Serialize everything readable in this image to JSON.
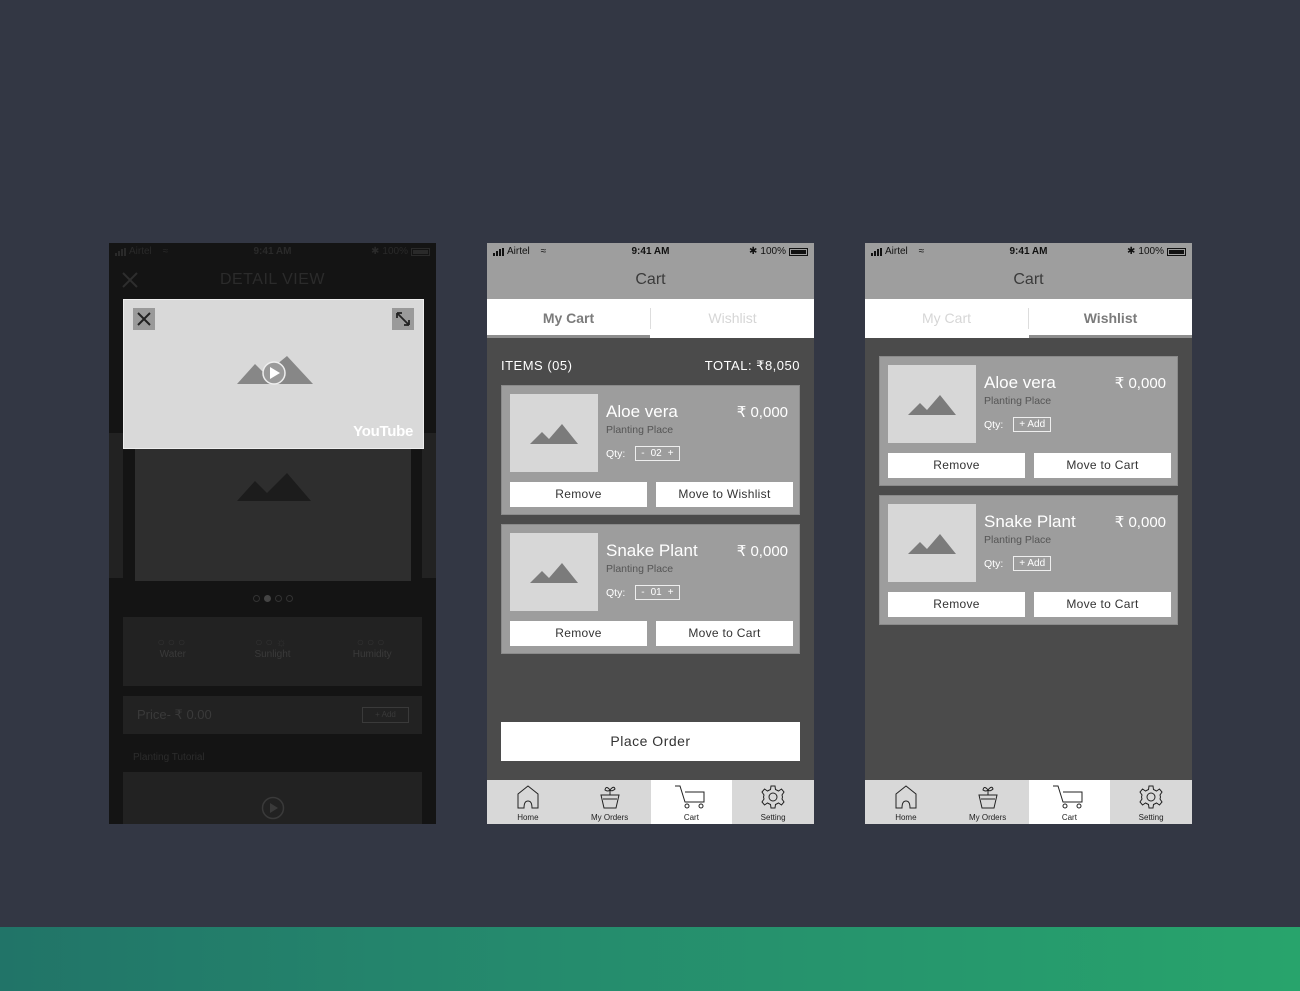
{
  "status_bar": {
    "carrier": "Airtel",
    "time": "9:41 AM",
    "battery": "100%"
  },
  "detail_screen": {
    "title": "DETAIL VIEW",
    "video": {
      "brand": "YouTube"
    },
    "carousel": {
      "dots": 4,
      "active_dot": 2
    },
    "care": [
      {
        "label": "Water",
        "icon": "water-drop-icon"
      },
      {
        "label": "Sunlight",
        "icon": "sun-icon"
      },
      {
        "label": "Humidity",
        "icon": "humidity-icon"
      }
    ],
    "price_label": "Price- ₹ 0.00",
    "add_label": "+ Add",
    "tutorial_label": "Planting Tutorial"
  },
  "cart_screen": {
    "title": "Cart",
    "tabs": [
      "My Cart",
      "Wishlist"
    ],
    "items_label": "ITEMS (05)",
    "total_label": "TOTAL:  ₹8,050",
    "items": [
      {
        "name": "Aloe vera",
        "price": "₹ 0,000",
        "place": "Planting Place",
        "qty_label": "Qty:",
        "qty": "02",
        "btn_left": "Remove",
        "btn_right": "Move to Wishlist"
      },
      {
        "name": "Snake Plant",
        "price": "₹ 0,000",
        "place": "Planting Place",
        "qty_label": "Qty:",
        "qty": "01",
        "btn_left": "Remove",
        "btn_right": "Move to Cart"
      }
    ],
    "place_order": "Place Order"
  },
  "wishlist_screen": {
    "title": "Cart",
    "tabs": [
      "My Cart",
      "Wishlist"
    ],
    "items": [
      {
        "name": "Aloe vera",
        "price": "₹ 0,000",
        "place": "Planting Place",
        "qty_label": "Qty:",
        "add": "+ Add",
        "btn_left": "Remove",
        "btn_right": "Move to Cart"
      },
      {
        "name": "Snake Plant",
        "price": "₹ 0,000",
        "place": "Planting Place",
        "qty_label": "Qty:",
        "add": "+ Add",
        "btn_left": "Remove",
        "btn_right": "Move to Cart"
      }
    ]
  },
  "bottom_nav": [
    {
      "label": "Home",
      "icon": "home-icon"
    },
    {
      "label": "My Orders",
      "icon": "plant-pot-icon"
    },
    {
      "label": "Cart",
      "icon": "cart-icon",
      "active": true
    },
    {
      "label": "Setting",
      "icon": "gear-icon"
    }
  ],
  "colors": {
    "background": "#333744",
    "band_start": "#217468",
    "band_end": "#28a46c"
  }
}
